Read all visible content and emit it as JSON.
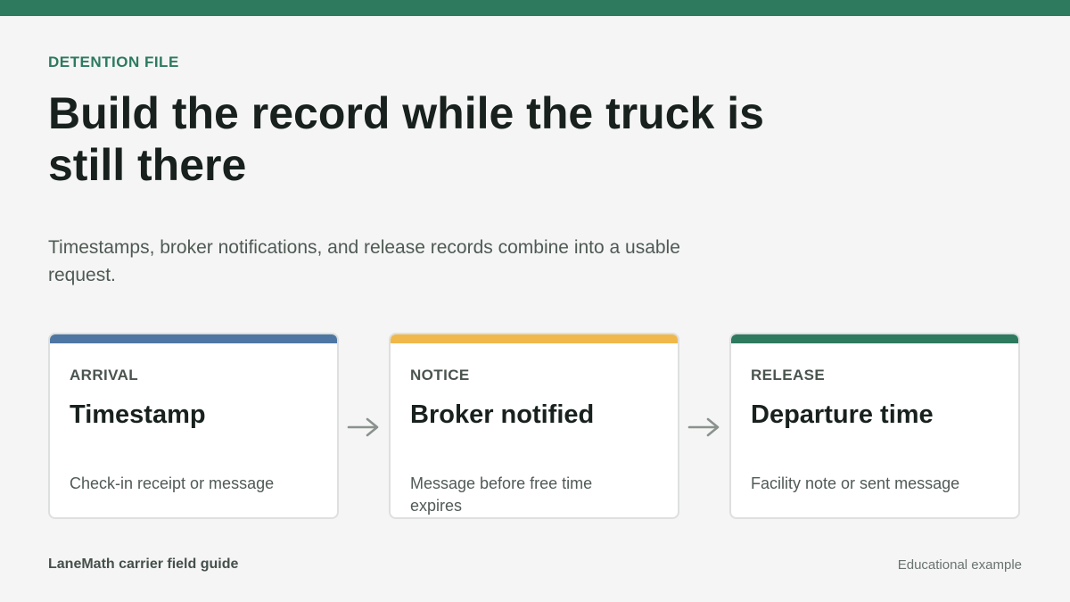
{
  "header": {
    "eyebrow": "DETENTION FILE",
    "title": "Build the record while the truck is still there",
    "subtitle": "Timestamps, broker notifications, and release records combine into a usable request."
  },
  "cards": [
    {
      "eyebrow": "ARRIVAL",
      "title": "Timestamp",
      "description": "Check-in receipt or message",
      "accent_color": "#4e76a3"
    },
    {
      "eyebrow": "NOTICE",
      "title": "Broker notified",
      "description": "Message before free time expires",
      "accent_color": "#f0b84a"
    },
    {
      "eyebrow": "RELEASE",
      "title": "Departure time",
      "description": "Facility note or sent message",
      "accent_color": "#2d7a5f"
    }
  ],
  "footer": {
    "left": "LaneMath carrier field guide",
    "right": "Educational example"
  },
  "colors": {
    "brand": "#2d7a5f",
    "background": "#f4f5f4",
    "arrow": "#8a928e"
  },
  "icons": {
    "step_arrow": "arrow-right-icon"
  }
}
